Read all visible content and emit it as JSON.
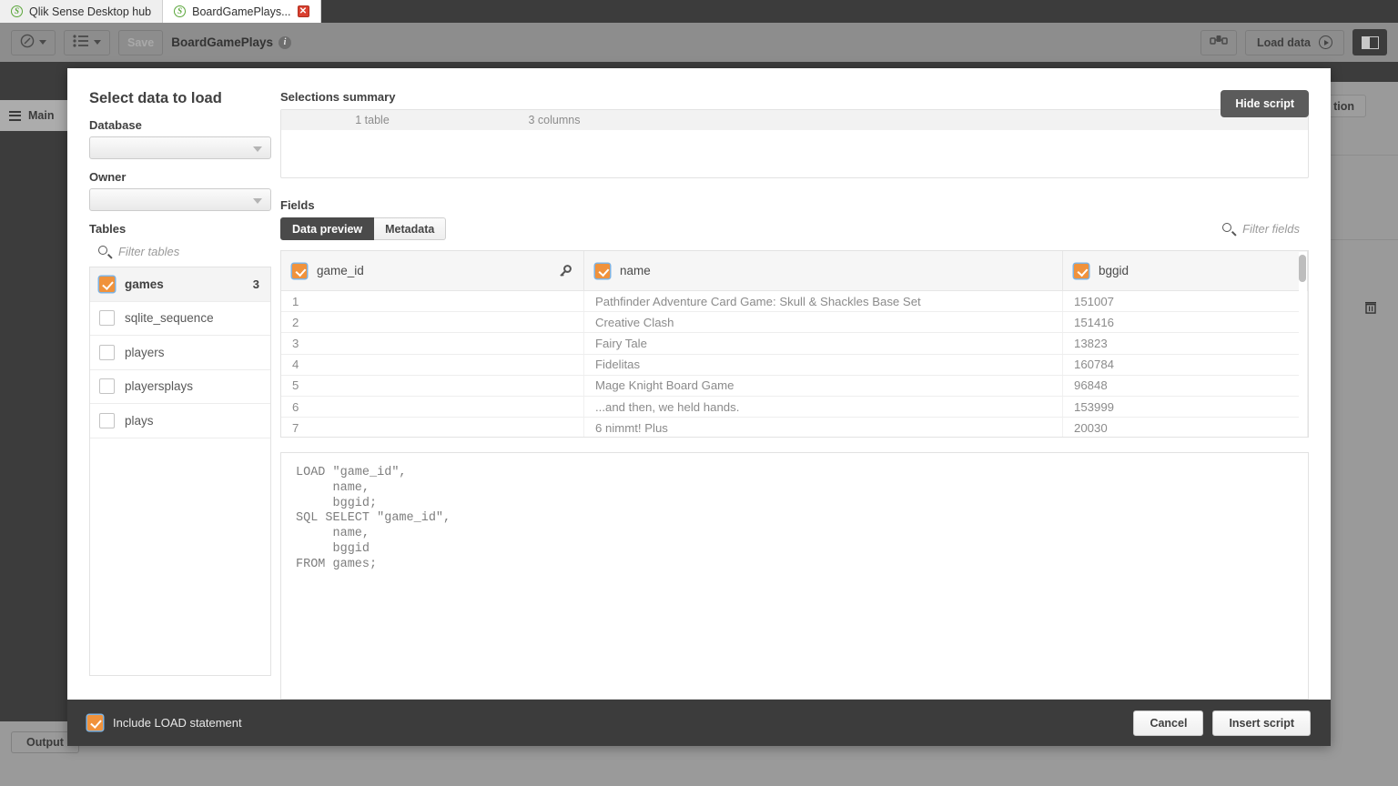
{
  "browser": {
    "tabs": [
      {
        "title": "Qlik Sense Desktop hub",
        "active": false,
        "closable": false
      },
      {
        "title": "BoardGamePlays...",
        "active": true,
        "closable": true
      }
    ],
    "close_glyph": "✕"
  },
  "toolbar": {
    "nav_icon": "compass-icon",
    "list_icon": "list-icon",
    "save_label": "Save",
    "app_title": "BoardGamePlays",
    "info_glyph": "i",
    "data_model_icon": "data-model-icon",
    "load_data_label": "Load data",
    "panel_toggle_icon": "right-panel-icon"
  },
  "background": {
    "sidebar_item": "Main",
    "connection_button_partial": "tion",
    "delete_icon": "trash-icon",
    "output_label": "Output"
  },
  "modal": {
    "title": "Select data to load",
    "hide_script_label": "Hide script",
    "database_label": "Database",
    "database_value": "",
    "owner_label": "Owner",
    "owner_value": "",
    "tables_label": "Tables",
    "filter_tables_placeholder": "Filter tables",
    "tables": [
      {
        "name": "games",
        "checked": true,
        "count": "3"
      },
      {
        "name": "sqlite_sequence",
        "checked": false,
        "count": ""
      },
      {
        "name": "players",
        "checked": false,
        "count": ""
      },
      {
        "name": "playersplays",
        "checked": false,
        "count": ""
      },
      {
        "name": "plays",
        "checked": false,
        "count": ""
      }
    ],
    "selections_summary_label": "Selections summary",
    "summary_tables": "1 table",
    "summary_columns": "3 columns",
    "fields_label": "Fields",
    "tab_data_preview": "Data preview",
    "tab_metadata": "Metadata",
    "filter_fields_placeholder": "Filter fields",
    "preview": {
      "columns": [
        {
          "name": "game_id",
          "checked": true,
          "key": true
        },
        {
          "name": "name",
          "checked": true,
          "key": false
        },
        {
          "name": "bggid",
          "checked": true,
          "key": false
        }
      ],
      "rows": [
        {
          "game_id": "1",
          "name": "Pathfinder Adventure Card Game: Skull & Shackles Base Set",
          "bggid": "151007"
        },
        {
          "game_id": "2",
          "name": "Creative Clash",
          "bggid": "151416"
        },
        {
          "game_id": "3",
          "name": "Fairy Tale",
          "bggid": "13823"
        },
        {
          "game_id": "4",
          "name": "Fidelitas",
          "bggid": "160784"
        },
        {
          "game_id": "5",
          "name": "Mage Knight Board Game",
          "bggid": "96848"
        },
        {
          "game_id": "6",
          "name": "...and then, we held hands.",
          "bggid": "153999"
        },
        {
          "game_id": "7",
          "name": "6 nimmt! Plus",
          "bggid": "20030"
        }
      ]
    },
    "script": "LOAD \"game_id\",\n     name,\n     bggid;\nSQL SELECT \"game_id\",\n     name,\n     bggid\nFROM games;",
    "include_load_label": "Include LOAD statement",
    "include_load_checked": true,
    "cancel_label": "Cancel",
    "insert_script_label": "Insert script"
  },
  "colors": {
    "accent": "#f0923c",
    "dark_chrome": "#3c3c3c",
    "app_bg": "#9a9a9a"
  }
}
